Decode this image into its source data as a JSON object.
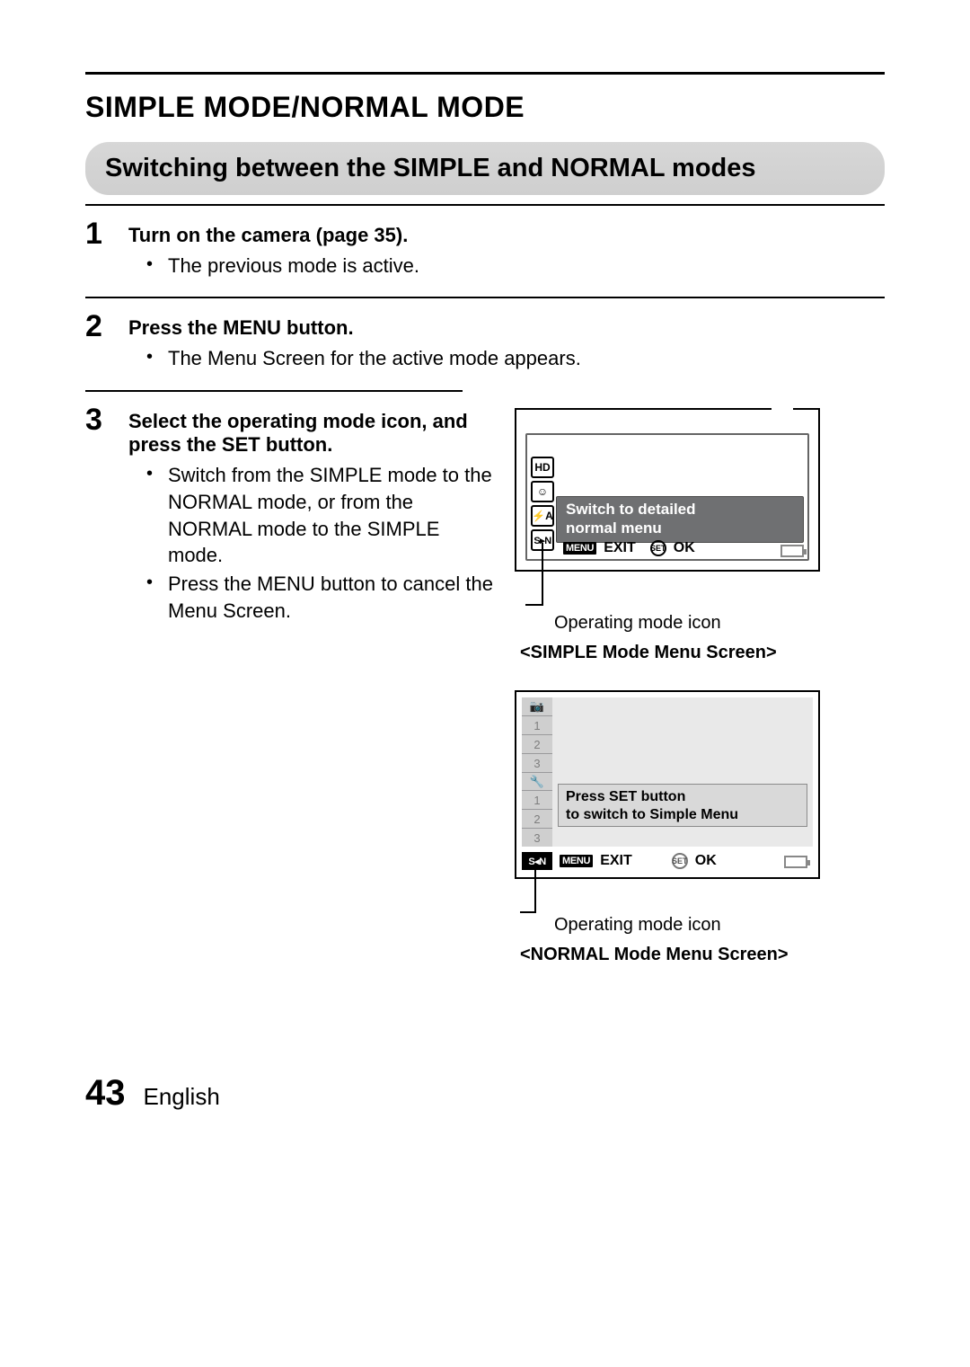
{
  "header": {
    "title": "SIMPLE MODE/NORMAL MODE",
    "subtitle": "Switching between the SIMPLE and NORMAL modes"
  },
  "steps": [
    {
      "num": "1",
      "title": "Turn on the camera (page 35).",
      "bullets": [
        "The previous mode is active."
      ]
    },
    {
      "num": "2",
      "title": "Press the MENU button.",
      "bullets": [
        "The Menu Screen for the active mode appears."
      ]
    },
    {
      "num": "3",
      "title": "Select the operating mode icon, and press the SET button.",
      "bullets": [
        "Switch from the SIMPLE mode to the NORMAL mode, or from the NORMAL mode to the SIMPLE mode.",
        "Press the MENU button to cancel the Menu Screen."
      ]
    }
  ],
  "lcd1": {
    "icons": {
      "hd": "HD",
      "face": "☺",
      "flash": "⚡A",
      "sn": "S▸N"
    },
    "msg_line1": "Switch to detailed",
    "msg_line2": "normal menu",
    "menu_chip": "MENU",
    "exit": "EXIT",
    "ok": "OK",
    "set": "SET",
    "pointer_label": "Operating mode icon",
    "caption": "<SIMPLE Mode Menu Screen>"
  },
  "lcd2": {
    "side": {
      "cam": "📷",
      "n1": "1",
      "n2": "2",
      "n3": "3",
      "wrench": "🔧",
      "m1": "1",
      "m2": "2",
      "m3": "3"
    },
    "msg_line1": "Press SET button",
    "msg_line2": "to switch to Simple Menu",
    "sn": "S◂N",
    "menu_chip": "MENU",
    "exit": "EXIT",
    "ok": "OK",
    "set": "SET",
    "pointer_label": "Operating mode icon",
    "caption": "<NORMAL Mode Menu Screen>"
  },
  "footer": {
    "page": "43",
    "language": "English"
  }
}
